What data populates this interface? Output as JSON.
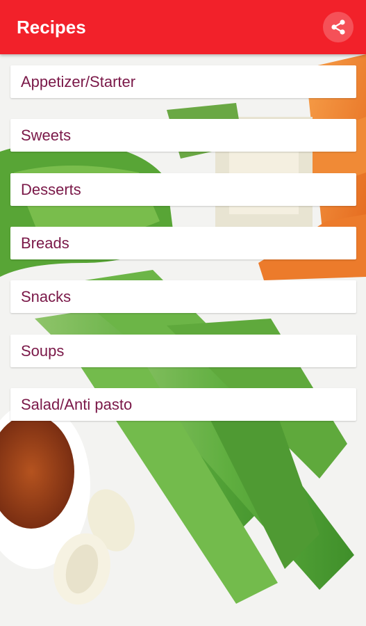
{
  "app_bar": {
    "title": "Recipes",
    "share_icon": "share-icon",
    "color": "#f2212a"
  },
  "categories": [
    {
      "label": "Appetizer/Starter"
    },
    {
      "label": "Sweets"
    },
    {
      "label": "Desserts"
    },
    {
      "label": "Breads"
    },
    {
      "label": "Snacks"
    },
    {
      "label": "Soups"
    },
    {
      "label": "Salad/Anti pasto"
    }
  ],
  "theme": {
    "label_color": "#7a1848",
    "background_image": "celery-garlic-carrots-photo"
  }
}
